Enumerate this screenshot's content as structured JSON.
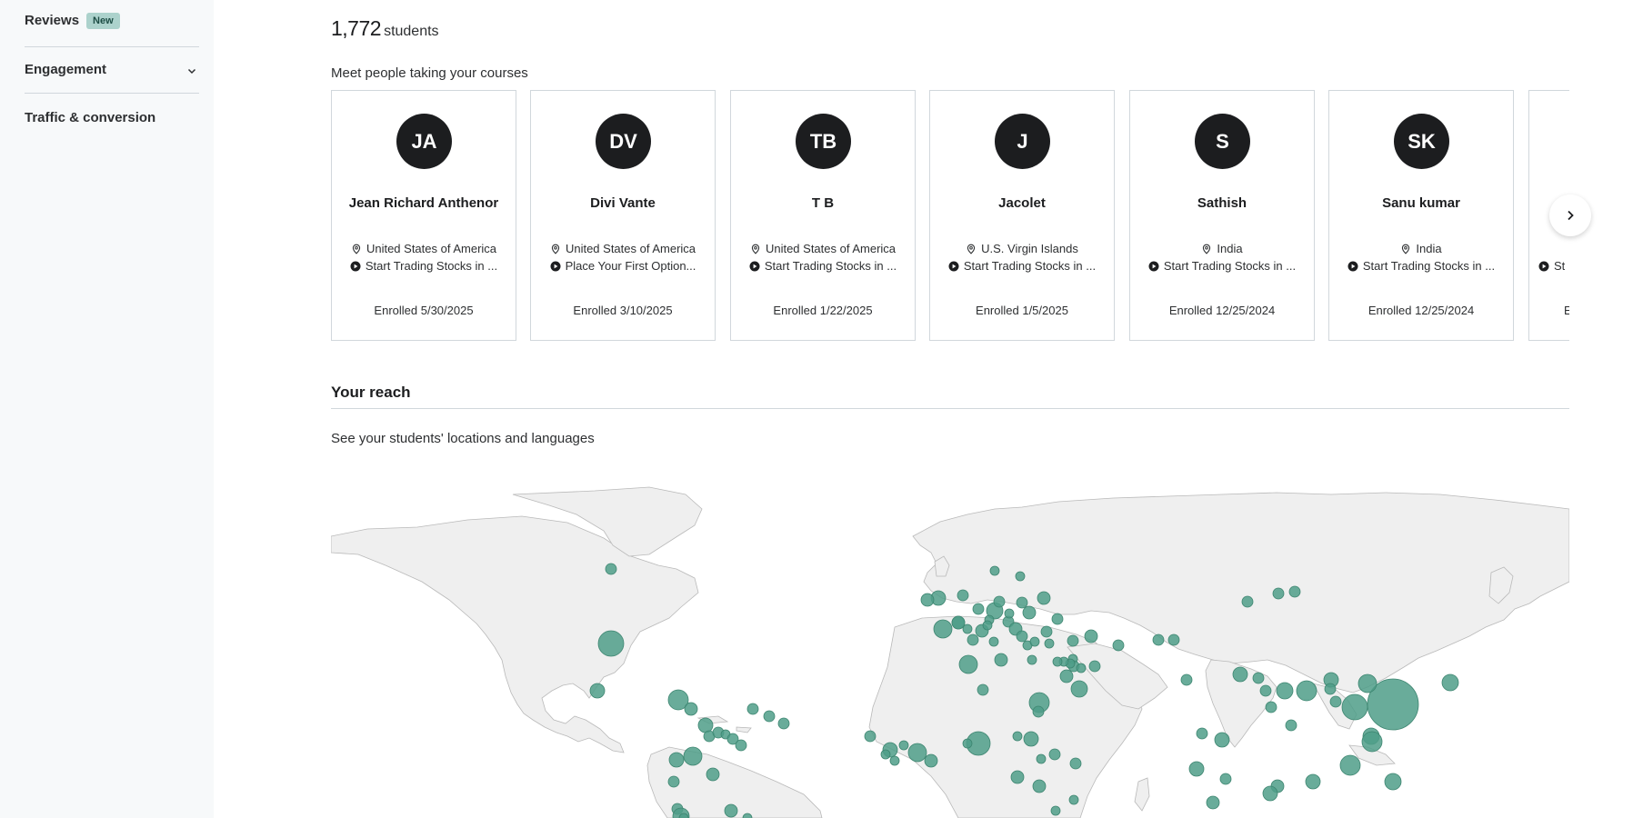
{
  "sidebar": {
    "reviews_label": "Reviews",
    "reviews_badge": "New",
    "engagement_label": "Engagement",
    "traffic_label": "Traffic & conversion"
  },
  "students": {
    "count": "1,772",
    "unit": "students",
    "meet_label": "Meet people taking your courses",
    "cards": [
      {
        "initials": "JA",
        "name": "Jean Richard Anthenor",
        "location": "United States of America",
        "course": "Start Trading Stocks in ...",
        "enrolled": "Enrolled 5/30/2025"
      },
      {
        "initials": "DV",
        "name": "Divi Vante",
        "location": "United States of America",
        "course": "Place Your First Option...",
        "enrolled": "Enrolled 3/10/2025"
      },
      {
        "initials": "TB",
        "name": "T B",
        "location": "United States of America",
        "course": "Start Trading Stocks in ...",
        "enrolled": "Enrolled 1/22/2025"
      },
      {
        "initials": "J",
        "name": "Jacolet",
        "location": "U.S. Virgin Islands",
        "course": "Start Trading Stocks in ...",
        "enrolled": "Enrolled 1/5/2025"
      },
      {
        "initials": "S",
        "name": "Sathish",
        "location": "India",
        "course": "Start Trading Stocks in ...",
        "enrolled": "Enrolled 12/25/2024"
      },
      {
        "initials": "SK",
        "name": "Sanu kumar",
        "location": "India",
        "course": "Start Trading Stocks in ...",
        "enrolled": "Enrolled 12/25/2024"
      },
      {
        "initials": "",
        "name": "",
        "location": "",
        "course": "St",
        "enrolled": "E"
      }
    ]
  },
  "reach": {
    "title": "Your reach",
    "subtitle": "See your students' locations and languages"
  },
  "colors": {
    "bubble": "#4f9e88",
    "land": "#efefef",
    "avatar": "#1c1d1f",
    "badge": "#acd2cc"
  }
}
